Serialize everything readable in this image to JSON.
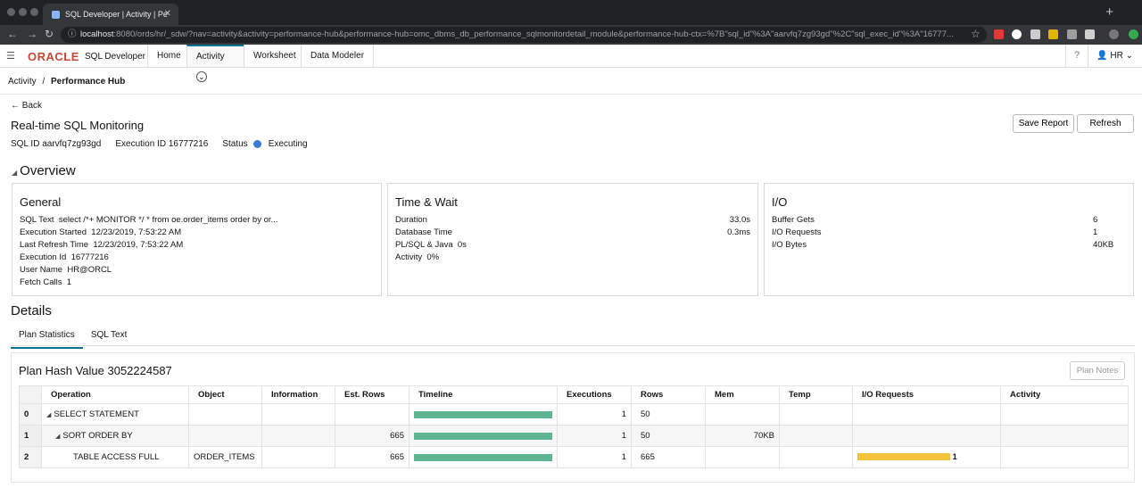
{
  "browser": {
    "tab_title": "SQL Developer | Activity | Pe",
    "url_host": "localhost",
    "url_rest": ":8080/ords/hr/_sdw/?nav=activity&activity=performance-hub&performance-hub=omc_dbms_db_performance_sqlmonitordetail_module&performance-hub-ctx=%7B\"sql_id\"%3A\"aarvfq7zg93gd\"%2C\"sql_exec_id\"%3A\"16777..."
  },
  "header": {
    "logo": "ORACLE",
    "product": "SQL Developer",
    "nav": [
      "Home",
      "Activity",
      "Worksheet",
      "Data Modeler"
    ],
    "user": "HR"
  },
  "breadcrumb": {
    "parent": "Activity",
    "sep": "/",
    "current": "Performance Hub"
  },
  "page": {
    "back": "Back",
    "title": "Real-time SQL Monitoring",
    "save_report": "Save Report",
    "refresh": "Refresh",
    "sql_id": "SQL ID aarvfq7zg93gd",
    "exec_id": "Execution ID 16777216",
    "status_label": "Status",
    "status_value": "Executing"
  },
  "overview": {
    "heading": "Overview",
    "general": {
      "title": "General",
      "rows": [
        {
          "k": "SQL Text",
          "v": "select /*+ MONITOR */ * from oe.order_items order by or..."
        },
        {
          "k": "Execution Started",
          "v": "12/23/2019, 7:53:22 AM"
        },
        {
          "k": "Last Refresh Time",
          "v": "12/23/2019, 7:53:22 AM"
        },
        {
          "k": "Execution Id",
          "v": "16777216"
        },
        {
          "k": "User Name",
          "v": "HR@ORCL"
        },
        {
          "k": "Fetch Calls",
          "v": "1"
        }
      ]
    },
    "time_wait": {
      "title": "Time & Wait",
      "rows": [
        {
          "k": "Duration",
          "v": "33.0s"
        },
        {
          "k": "Database Time",
          "v": "0.3ms"
        },
        {
          "k": "PL/SQL & Java",
          "v": "0s"
        },
        {
          "k": "Activity",
          "v": "0%"
        }
      ]
    },
    "io": {
      "title": "I/O",
      "rows": [
        {
          "k": "Buffer Gets",
          "v": "6"
        },
        {
          "k": "I/O Requests",
          "v": "1"
        },
        {
          "k": "I/O Bytes",
          "v": "40KB"
        }
      ]
    }
  },
  "details": {
    "heading": "Details",
    "tabs": [
      "Plan Statistics",
      "SQL Text"
    ],
    "plan_hash": "Plan Hash Value 3052224587",
    "plan_notes": "Plan Notes",
    "columns": [
      "Operation",
      "Object",
      "Information",
      "Est. Rows",
      "Timeline",
      "Executions",
      "Rows",
      "Mem",
      "Temp",
      "I/O Requests",
      "Activity"
    ],
    "rows": [
      {
        "id": "0",
        "operation": "SELECT STATEMENT",
        "object": "",
        "est_rows": "",
        "executions": "1",
        "rows": "50",
        "mem": "",
        "io": ""
      },
      {
        "id": "1",
        "operation": "SORT ORDER BY",
        "object": "",
        "est_rows": "665",
        "executions": "1",
        "rows": "50",
        "mem": "70KB",
        "io": ""
      },
      {
        "id": "2",
        "operation": "TABLE ACCESS FULL",
        "object": "ORDER_ITEMS",
        "est_rows": "665",
        "executions": "1",
        "rows": "665",
        "mem": "",
        "io": "1"
      }
    ]
  }
}
